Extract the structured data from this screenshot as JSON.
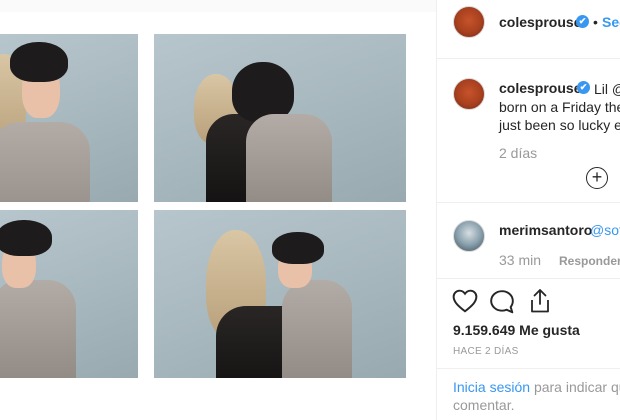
{
  "post": {
    "author": "colesprouse",
    "follow_label": "Seg",
    "caption_author": "colesprouse",
    "caption_lines": [
      "Lil @",
      "born on a Friday the",
      "just been so lucky ev"
    ],
    "caption_time": "2 días"
  },
  "comment": {
    "author": "merimsantoro",
    "text": "@sof",
    "time": "33 min",
    "reply_label": "Responder"
  },
  "likes": "9.159.649 Me gusta",
  "posted_ago": "HACE 2 DÍAS",
  "login_prompt": {
    "link": "Inicia sesión",
    "rest": "para indicar que",
    "line2": "comentar."
  },
  "icons": {
    "verified": "✔",
    "bullet": "•",
    "add_comments": "+",
    "like": "heart-icon",
    "comment": "speech-bubble-icon",
    "share": "share-icon"
  }
}
